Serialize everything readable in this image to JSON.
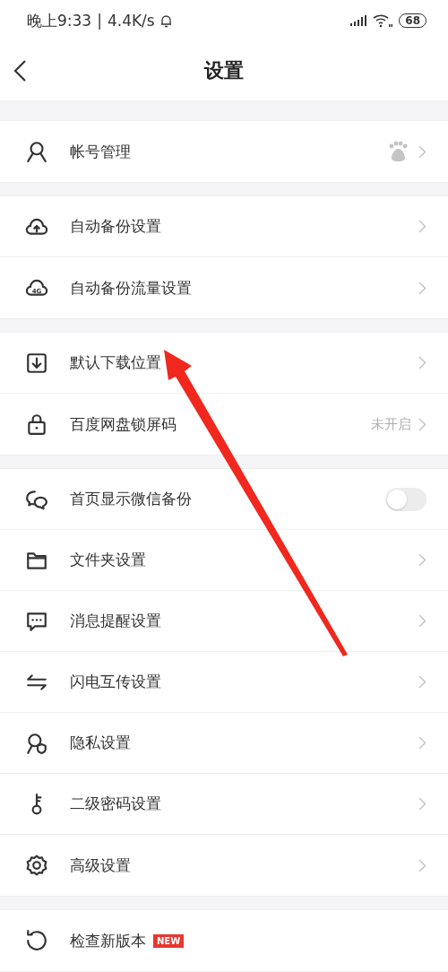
{
  "status_bar": {
    "time": "晚上9:33",
    "separator": "|",
    "speed": "4.4K/s",
    "battery": "68"
  },
  "header": {
    "title": "设置"
  },
  "groups": [
    {
      "items": [
        {
          "kind": "avatar",
          "label": "帐号管理"
        }
      ]
    },
    {
      "items": [
        {
          "kind": "chevron",
          "label": "自动备份设置"
        },
        {
          "kind": "chevron",
          "label": "自动备份流量设置",
          "icon_text": "4G"
        }
      ]
    },
    {
      "items": [
        {
          "kind": "chevron",
          "label": "默认下载位置"
        },
        {
          "kind": "chevron",
          "label": "百度网盘锁屏码",
          "value": "未开启"
        }
      ]
    },
    {
      "items": [
        {
          "kind": "toggle",
          "label": "首页显示微信备份",
          "on": false
        },
        {
          "kind": "chevron",
          "label": "文件夹设置"
        },
        {
          "kind": "chevron",
          "label": "消息提醒设置"
        },
        {
          "kind": "chevron",
          "label": "闪电互传设置"
        },
        {
          "kind": "chevron",
          "label": "隐私设置"
        },
        {
          "kind": "chevron",
          "label": "二级密码设置"
        },
        {
          "kind": "chevron",
          "label": "高级设置"
        }
      ]
    },
    {
      "items": [
        {
          "kind": "none",
          "label": "检查新版本",
          "badge": "NEW"
        }
      ]
    }
  ]
}
